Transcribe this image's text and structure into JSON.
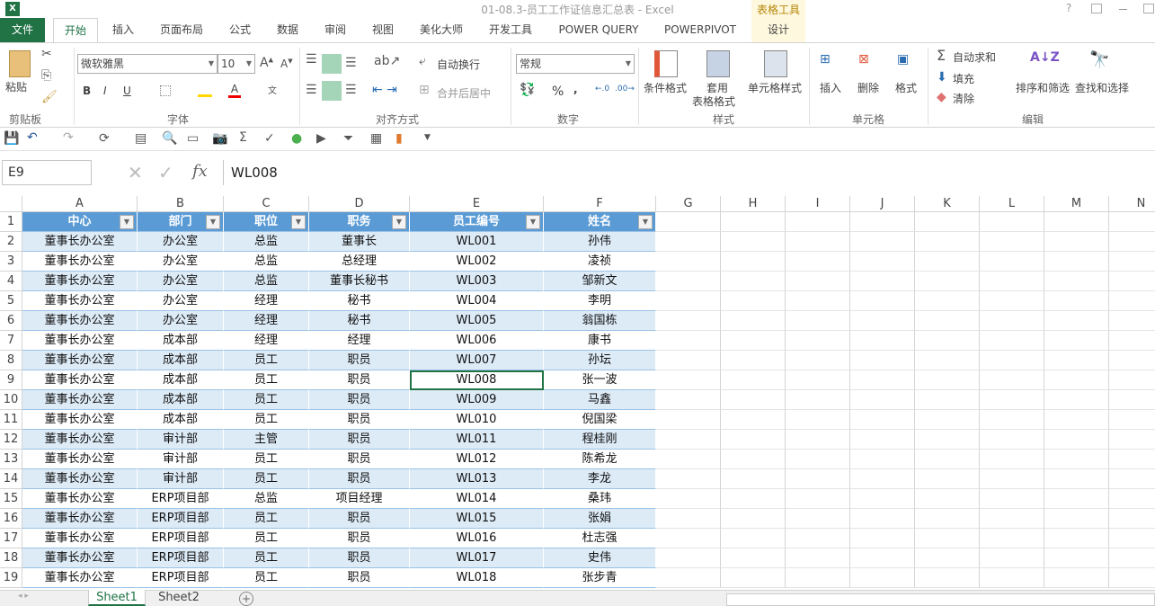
{
  "title": "01-08.3-员工工作证信息汇总表 - Excel",
  "context_tab_group": "表格工具",
  "window_controls": [
    "?",
    "restore-ribbon",
    "minimize",
    "maximize"
  ],
  "tabs": [
    "文件",
    "开始",
    "插入",
    "页面布局",
    "公式",
    "数据",
    "审阅",
    "视图",
    "美化大师",
    "开发工具",
    "POWER QUERY",
    "POWERPIVOT",
    "设计"
  ],
  "ribbon": {
    "clipboard": {
      "paste": "粘贴",
      "group": "剪贴板"
    },
    "font": {
      "name": "微软雅黑",
      "size": "10",
      "bold": "B",
      "italic": "I",
      "underline": "U",
      "group": "字体"
    },
    "align": {
      "wrap": "自动换行",
      "merge": "合并后居中",
      "group": "对齐方式"
    },
    "number": {
      "format": "常规",
      "percent": "%",
      "comma": ",",
      "group": "数字"
    },
    "styles": {
      "cond": "条件格式",
      "table1": "套用",
      "table2": "表格格式",
      "cell": "单元格样式",
      "group": "样式"
    },
    "cells": {
      "insert": "插入",
      "delete": "删除",
      "format": "格式",
      "group": "单元格"
    },
    "editing": {
      "autosum": "自动求和",
      "fill": "填充",
      "clear": "清除",
      "sort": "排序和筛选",
      "find": "查找和选择",
      "group": "编辑"
    }
  },
  "namebox": "E9",
  "formula": "WL008",
  "fx": "fx",
  "columns": [
    "A",
    "B",
    "C",
    "D",
    "E",
    "F",
    "G",
    "H",
    "I",
    "J",
    "K",
    "L",
    "M",
    "N"
  ],
  "table": {
    "headers": [
      "中心",
      "部门",
      "职位",
      "职务",
      "员工编号",
      "姓名"
    ],
    "rows": [
      [
        "董事长办公室",
        "办公室",
        "总监",
        "董事长",
        "WL001",
        "孙伟"
      ],
      [
        "董事长办公室",
        "办公室",
        "总监",
        "总经理",
        "WL002",
        "凌祯"
      ],
      [
        "董事长办公室",
        "办公室",
        "总监",
        "董事长秘书",
        "WL003",
        "邹新文"
      ],
      [
        "董事长办公室",
        "办公室",
        "经理",
        "秘书",
        "WL004",
        "李明"
      ],
      [
        "董事长办公室",
        "办公室",
        "经理",
        "秘书",
        "WL005",
        "翁国栋"
      ],
      [
        "董事长办公室",
        "成本部",
        "经理",
        "经理",
        "WL006",
        "康书"
      ],
      [
        "董事长办公室",
        "成本部",
        "员工",
        "职员",
        "WL007",
        "孙坛"
      ],
      [
        "董事长办公室",
        "成本部",
        "员工",
        "职员",
        "WL008",
        "张一波"
      ],
      [
        "董事长办公室",
        "成本部",
        "员工",
        "职员",
        "WL009",
        "马鑫"
      ],
      [
        "董事长办公室",
        "成本部",
        "员工",
        "职员",
        "WL010",
        "倪国梁"
      ],
      [
        "董事长办公室",
        "审计部",
        "主管",
        "职员",
        "WL011",
        "程桂刚"
      ],
      [
        "董事长办公室",
        "审计部",
        "员工",
        "职员",
        "WL012",
        "陈希龙"
      ],
      [
        "董事长办公室",
        "审计部",
        "员工",
        "职员",
        "WL013",
        "李龙"
      ],
      [
        "董事长办公室",
        "ERP项目部",
        "总监",
        "项目经理",
        "WL014",
        "桑玮"
      ],
      [
        "董事长办公室",
        "ERP项目部",
        "员工",
        "职员",
        "WL015",
        "张娟"
      ],
      [
        "董事长办公室",
        "ERP项目部",
        "员工",
        "职员",
        "WL016",
        "杜志强"
      ],
      [
        "董事长办公室",
        "ERP项目部",
        "员工",
        "职员",
        "WL017",
        "史伟"
      ],
      [
        "董事长办公室",
        "ERP项目部",
        "员工",
        "职员",
        "WL018",
        "张步青"
      ]
    ]
  },
  "sheets": [
    "Sheet1",
    "Sheet2"
  ],
  "colors": {
    "brand": "#217346",
    "table_header": "#5b9bd5",
    "band": "#ddebf7"
  }
}
